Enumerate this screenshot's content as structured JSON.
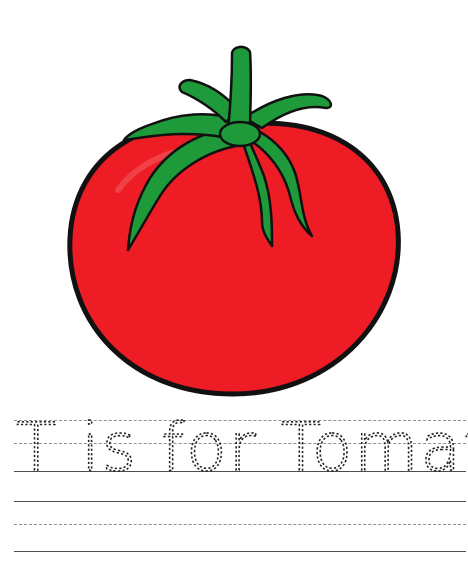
{
  "worksheet": {
    "trace_text": "T is for Tomato",
    "illustration_icon": "tomato-icon",
    "colors": {
      "tomato_red": "#ee1d25",
      "leaf_green": "#1f9a3a",
      "outline": "#111111",
      "rule_solid": "#4d4d4d",
      "rule_dashed": "#8f8f8f"
    }
  }
}
